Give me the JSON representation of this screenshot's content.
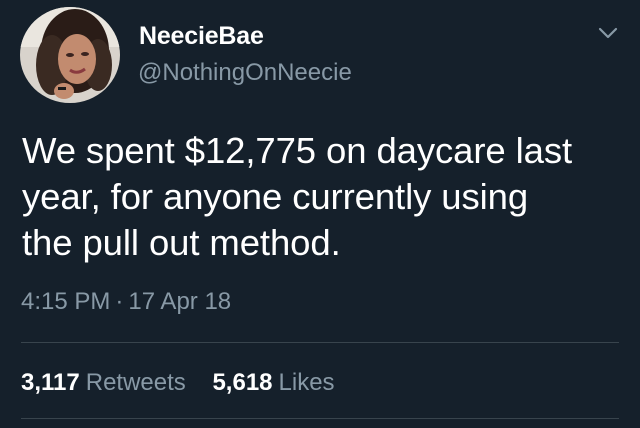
{
  "tweet": {
    "display_name": "NeecieBae",
    "handle": "@NothingOnNeecie",
    "text_lines": [
      "We spent $12,775 on daycare last",
      "year, for anyone currently using",
      "the pull out method."
    ],
    "time": "4:15 PM",
    "separator": "·",
    "date": "17 Apr 18",
    "retweets": {
      "count": "3,117",
      "label": "Retweets"
    },
    "likes": {
      "count": "5,618",
      "label": "Likes"
    }
  },
  "icons": {
    "menu": "chevron-down-icon",
    "avatar": "profile-photo"
  },
  "colors": {
    "background": "#15202b",
    "primary_text": "#ffffff",
    "secondary_text": "#8899a6",
    "divider": "#38444d"
  }
}
